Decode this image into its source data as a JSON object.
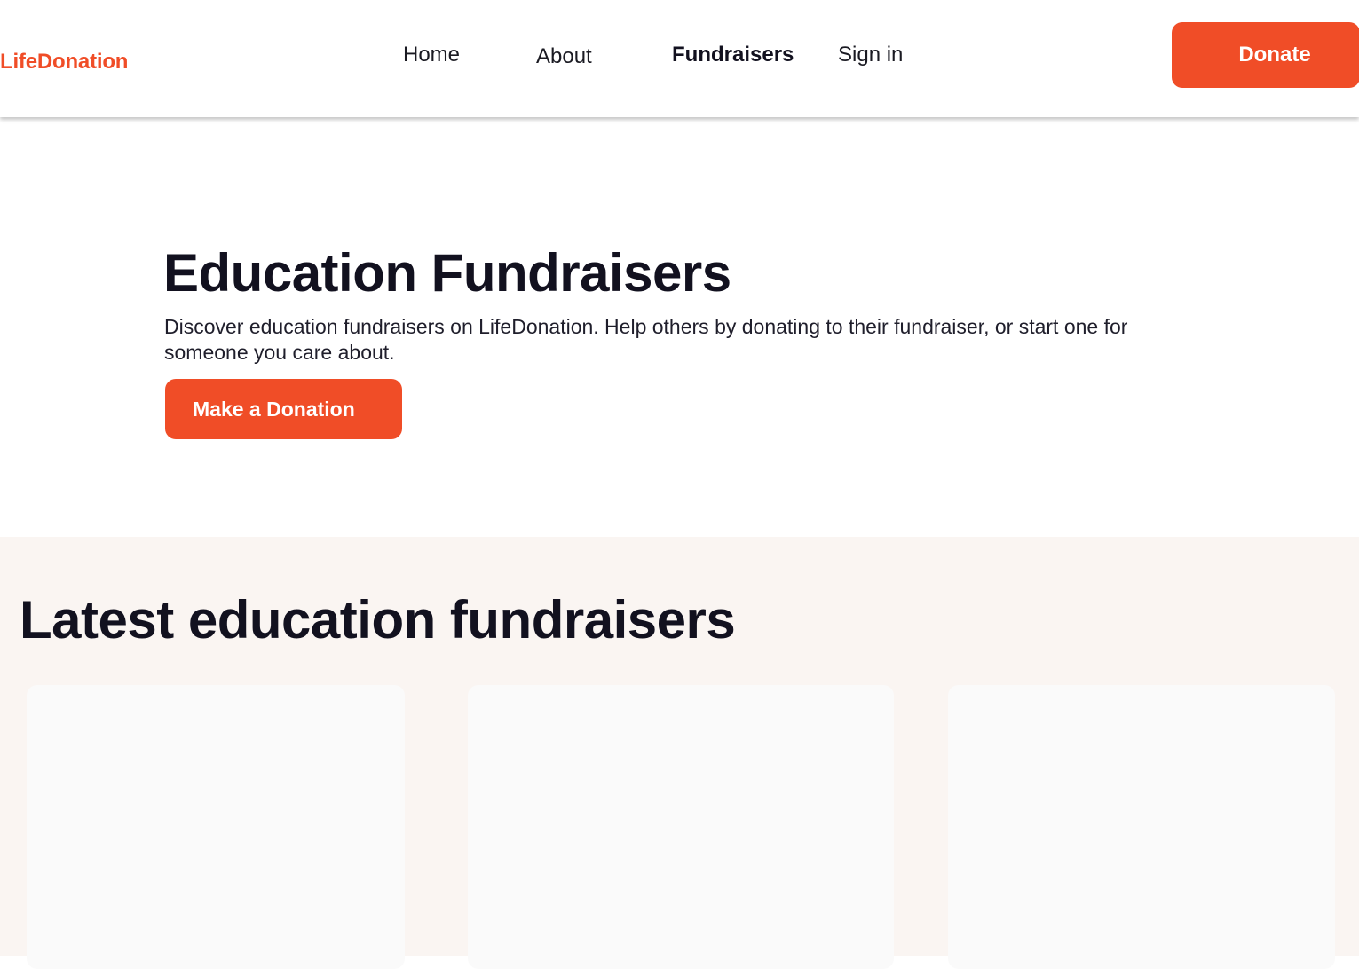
{
  "header": {
    "logo": "LifeDonation",
    "nav": {
      "home": "Home",
      "about": "About",
      "fundraisers": "Fundraisers",
      "signin": "Sign in"
    },
    "donate_label": "Donate"
  },
  "hero": {
    "title": "Education Fundraisers",
    "description": "Discover education fundraisers on LifeDonation. Help others by donating to their fundraiser, or start one for someone you care about.",
    "cta_label": "Make a Donation"
  },
  "latest": {
    "title": "Latest education fundraisers"
  },
  "colors": {
    "accent": "#f04d27",
    "text": "#12111f",
    "section_bg": "#faf5f2",
    "card_bg": "#fafafa"
  }
}
